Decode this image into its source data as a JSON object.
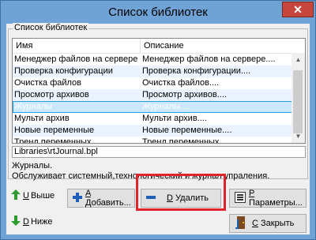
{
  "window": {
    "title": "Список библиотек",
    "close_glyph": "✕"
  },
  "group": {
    "label": "Список библиотек"
  },
  "table": {
    "columns": [
      "Имя",
      "Описание"
    ],
    "rows": [
      [
        "Менеджер файлов на сервере",
        "Менеджер файлов на сервере...."
      ],
      [
        "Проверка конфигурации",
        "Проверка конфигурации...."
      ],
      [
        "Очистка файлов",
        "Очистка файлов...."
      ],
      [
        "Просмотр архивов",
        "Просмотр архивов...."
      ],
      [
        "Журналы",
        "Журналы...."
      ],
      [
        "Мульти архив",
        "Мульти архив...."
      ],
      [
        "Новые переменные",
        "Новые переменные...."
      ],
      [
        "Тренд переменных",
        "Тренд переменных...."
      ]
    ],
    "selected_index": 4
  },
  "path": "Libraries\\rtJournal.bpl",
  "description": {
    "line1": "Журналы.",
    "line2": "Обслуживает системный,технологический и журнал упраления."
  },
  "buttons": {
    "up": {
      "key": "U",
      "label": "Выше"
    },
    "down": {
      "key": "D",
      "label": "Ниже"
    },
    "add": {
      "key": "A",
      "label": "Добавить..."
    },
    "delete": {
      "key": "D",
      "label": "Удалить"
    },
    "params": {
      "key": "P",
      "label": "Параметры..."
    },
    "close": {
      "key": "C",
      "label": "Закрыть"
    }
  },
  "colors": {
    "highlight_frame": "#e0242a",
    "selection": "#cce8ff"
  }
}
